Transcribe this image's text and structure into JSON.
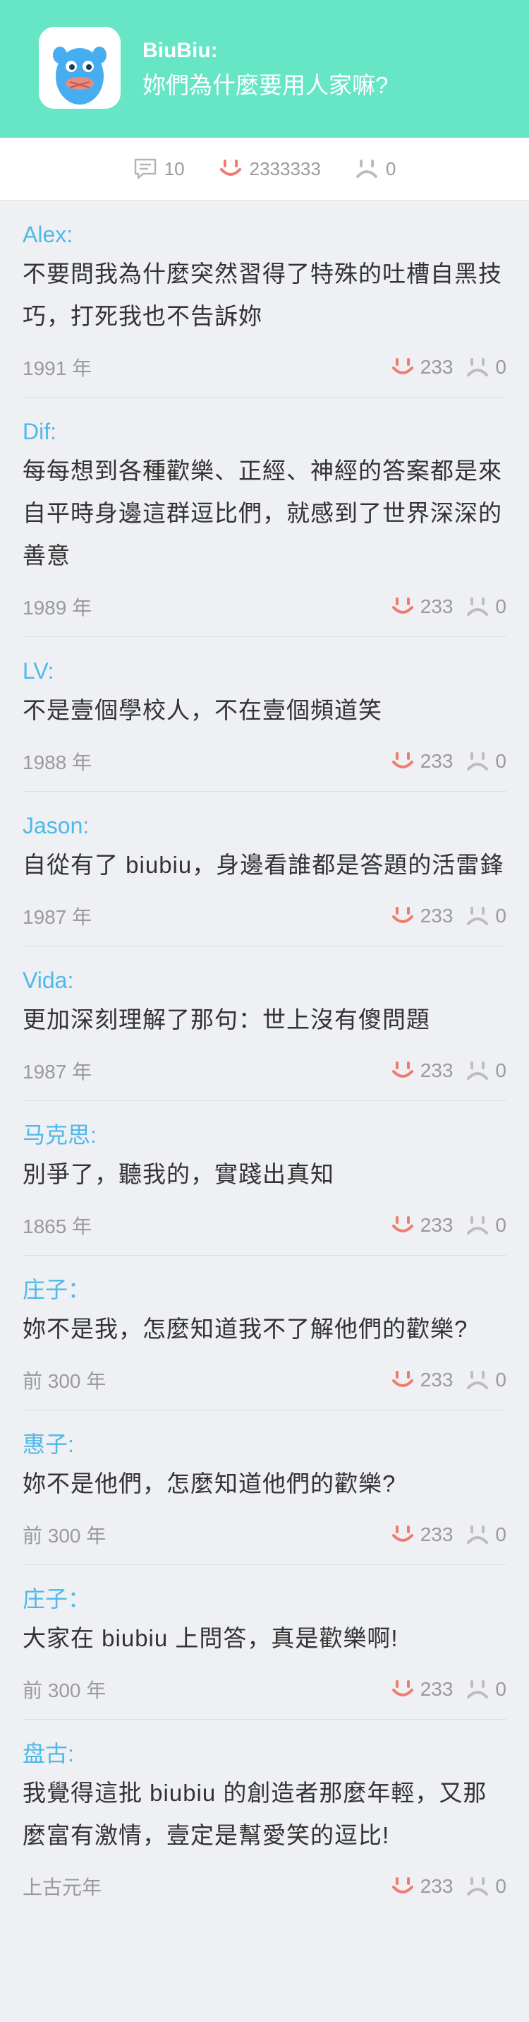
{
  "header": {
    "app_name": "BiuBiu:",
    "question": "妳們為什麼要用人家嘛?",
    "colors": {
      "background": "#66e6c4",
      "mascot": "#46aef0",
      "mascot_cheek": "#e98a7f"
    }
  },
  "stats": {
    "comments_icon": "comment-icon",
    "comments_count": "10",
    "likes_icon": "smile-icon",
    "likes_count": "2333333",
    "dislikes_icon": "frown-icon",
    "dislikes_count": "0"
  },
  "comments": [
    {
      "author": "Alex:",
      "text": "不要問我為什麼突然習得了特殊的吐槽自黑技巧，打死我也不告訴妳",
      "year": "1991 年",
      "likes": "233",
      "dislikes": "0"
    },
    {
      "author": "Dif:",
      "text": "每每想到各種歡樂、正經、神經的答案都是來自平時身邊這群逗比們，就感到了世界深深的善意",
      "year": "1989 年",
      "likes": "233",
      "dislikes": "0"
    },
    {
      "author": "LV:",
      "text": "不是壹個學校人，不在壹個頻道笑",
      "year": "1988 年",
      "likes": "233",
      "dislikes": "0"
    },
    {
      "author": "Jason:",
      "text": "自從有了 biubiu，身邊看誰都是答題的活雷鋒",
      "year": "1987 年",
      "likes": "233",
      "dislikes": "0"
    },
    {
      "author": "Vida:",
      "text": "更加深刻理解了那句：世上沒有傻問題",
      "year": "1987 年",
      "likes": "233",
      "dislikes": "0"
    },
    {
      "author": "马克思:",
      "text": "別爭了，聽我的，實踐出真知",
      "year": "1865 年",
      "likes": "233",
      "dislikes": "0"
    },
    {
      "author": "庄子：",
      "text": "妳不是我，怎麼知道我不了解他們的歡樂?",
      "year": "前 300 年",
      "likes": "233",
      "dislikes": "0"
    },
    {
      "author": "惠子:",
      "text": "妳不是他們，怎麼知道他們的歡樂?",
      "year": "前 300 年",
      "likes": "233",
      "dislikes": "0"
    },
    {
      "author": "庄子：",
      "text": "大家在 biubiu 上問答，真是歡樂啊!",
      "year": "前 300 年",
      "likes": "233",
      "dislikes": "0"
    },
    {
      "author": "盘古:",
      "text": "我覺得這批 biubiu 的創造者那麼年輕，又那麼富有激情，壹定是幫愛笑的逗比!",
      "year": "上古元年",
      "likes": "233",
      "dislikes": "0"
    }
  ]
}
